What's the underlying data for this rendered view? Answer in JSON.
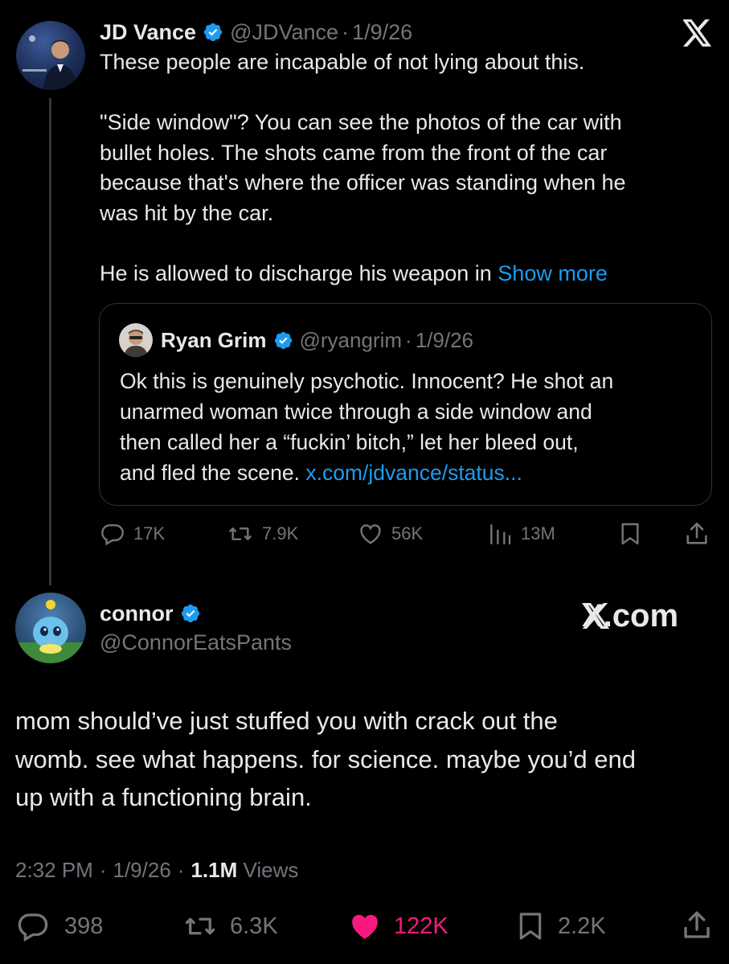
{
  "parent_tweet": {
    "author_name": "JD Vance",
    "handle": "@JDVance",
    "separator": "·",
    "date": "1/9/26",
    "lines": [
      "These people are incapable of not lying about this.",
      "",
      "\"Side window\"? You can see the photos of the car with",
      "bullet holes. The shots came from the front of the car",
      "because that's where the officer was standing when he",
      "was hit by the car.",
      "",
      "He is allowed to discharge his weapon in"
    ],
    "show_more": "Show more",
    "quote": {
      "author_name": "Ryan Grim",
      "handle": "@ryangrim",
      "separator": "·",
      "date": "1/9/26",
      "lines": [
        "Ok this is genuinely psychotic. Innocent? He shot an",
        "unarmed woman twice through a side window and",
        "then called her a “fuckin’ bitch,” let her bleed out,",
        "and fled the scene."
      ],
      "link": "x.com/jdvance/status..."
    },
    "stats": {
      "replies": "17K",
      "reposts": "7.9K",
      "likes": "56K",
      "views": "13M"
    }
  },
  "reply_tweet": {
    "author_name": "connor",
    "handle": "@ConnorEatsPants",
    "watermark": "X.com",
    "lines": [
      "mom should’ve just stuffed you with crack out the",
      "womb. see what happens. for science. maybe you’d end",
      "up with a functioning brain."
    ],
    "time": "2:32 PM",
    "date": "1/9/26",
    "separator": "·",
    "views_count": "1.1M",
    "views_label": "Views",
    "stats": {
      "replies": "398",
      "reposts": "6.3K",
      "likes": "122K",
      "bookmarks": "2.2K"
    }
  },
  "icons": {
    "close": "x-logo-icon",
    "verified": "verified-badge-icon",
    "reply": "reply-icon",
    "repost": "repost-icon",
    "like": "heart-icon",
    "views": "views-icon",
    "bookmark": "bookmark-icon",
    "share": "share-icon"
  },
  "colors": {
    "background": "#000000",
    "text": "#e7e9ea",
    "muted": "#71767b",
    "link": "#1d9bf0",
    "like_active": "#f91880",
    "verified": "#1d9bf0"
  }
}
